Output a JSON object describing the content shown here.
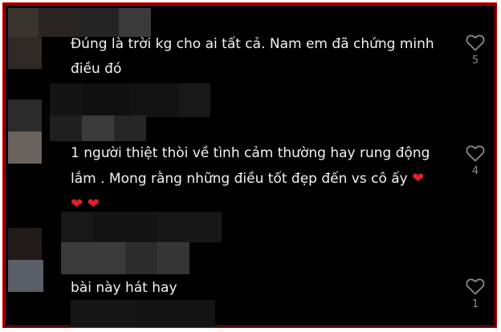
{
  "comments": [
    {
      "text": "Đúng là trời kg cho ai tất cả. Nam em đã chứng minh điều đó",
      "like_count": "5"
    },
    {
      "text": "1 người thiệt thòi về tình cảm thường hay rung động lắm . Mong rằng những điều tốt đẹp đến vs cô ấy",
      "emoji": "❤",
      "emoji_tail": "❤ ❤",
      "like_count": "4"
    },
    {
      "text": "bài này hát hay",
      "like_count": "1"
    }
  ],
  "colors": {
    "background": "#000000",
    "text": "#f2f2f2",
    "muted": "#8a8a8a",
    "border": "#d40000",
    "heart_emoji": "#e0202a"
  },
  "icons": {
    "like": "heart-outline-icon"
  }
}
